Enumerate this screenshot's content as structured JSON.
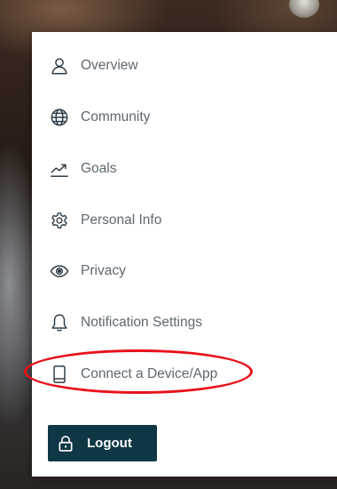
{
  "menu": {
    "items": [
      {
        "label": "Overview",
        "icon": "user-icon"
      },
      {
        "label": "Community",
        "icon": "globe-icon"
      },
      {
        "label": "Goals",
        "icon": "trend-up-icon"
      },
      {
        "label": "Personal Info",
        "icon": "gear-icon"
      },
      {
        "label": "Privacy",
        "icon": "eye-icon"
      },
      {
        "label": "Notification Settings",
        "icon": "bell-icon"
      },
      {
        "label": "Connect a Device/App",
        "icon": "phone-icon"
      }
    ],
    "logout_label": "Logout",
    "logout_icon": "lock-icon"
  },
  "colors": {
    "panel_background": "#ffffff",
    "icon": "#2e3b45",
    "label": "#5e6870",
    "logout_background": "#0f3746",
    "highlight_ring": "#e8101a"
  }
}
